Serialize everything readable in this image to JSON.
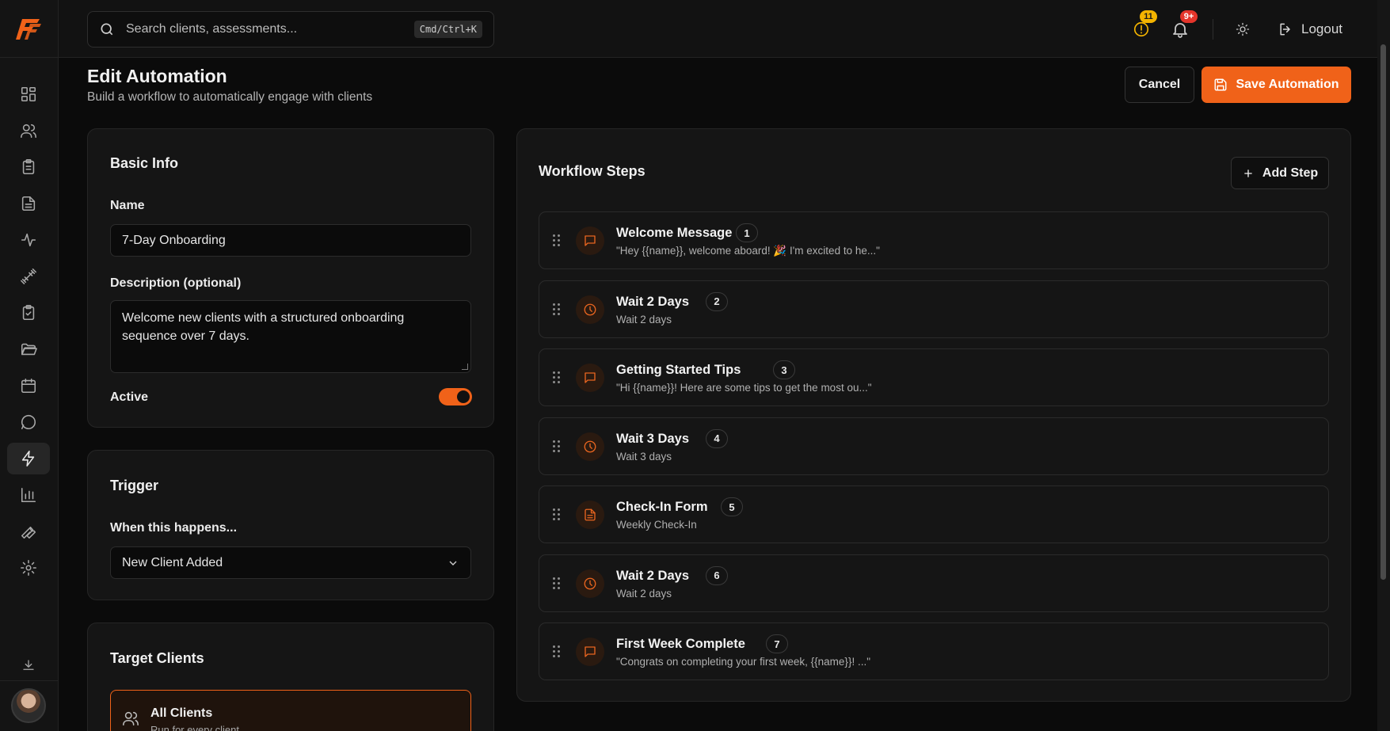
{
  "topbar": {
    "search_placeholder": "Search clients, assessments...",
    "search_shortcut": "Cmd/Ctrl+K",
    "alerts_badge": "11",
    "notifications_badge": "9+",
    "logout_label": "Logout"
  },
  "colors": {
    "accent": "#f06219",
    "background": "#0b0b0b",
    "card": "#151515"
  },
  "sidebar": {
    "logo": "FF",
    "items": [
      {
        "icon": "dashboard-icon"
      },
      {
        "icon": "users-icon"
      },
      {
        "icon": "clipboard-icon"
      },
      {
        "icon": "document-icon"
      },
      {
        "icon": "activity-icon"
      },
      {
        "icon": "dumbbell-icon"
      },
      {
        "icon": "clipboard-check-icon"
      },
      {
        "icon": "folder-icon"
      },
      {
        "icon": "calendar-icon"
      },
      {
        "icon": "chat-icon"
      },
      {
        "icon": "lightning-icon",
        "active": true
      },
      {
        "icon": "bar-chart-icon"
      },
      {
        "icon": "wrench-icon"
      },
      {
        "icon": "gear-icon"
      }
    ]
  },
  "header": {
    "title": "Edit Automation",
    "subtitle": "Build a workflow to automatically engage with clients",
    "cancel_label": "Cancel",
    "save_label": "Save Automation"
  },
  "basic_info": {
    "title": "Basic Info",
    "name_label": "Name",
    "name_value": "7-Day Onboarding",
    "description_label": "Description (optional)",
    "description_value": "Welcome new clients with a structured onboarding sequence over 7 days.",
    "active_label": "Active",
    "active": true
  },
  "trigger": {
    "title": "Trigger",
    "when_label": "When this happens...",
    "selected": "New Client Added"
  },
  "target": {
    "title": "Target Clients",
    "option_title": "All Clients",
    "option_sub": "Run for every client"
  },
  "workflow": {
    "title": "Workflow Steps",
    "add_label": "Add Step",
    "steps": [
      {
        "type": "message",
        "title": "Welcome Message",
        "num": "1",
        "sub": "\"Hey {{name}}, welcome aboard! 🎉 I'm excited to he...\""
      },
      {
        "type": "wait",
        "title": "Wait 2 Days",
        "num": "2",
        "sub": "Wait 2 days"
      },
      {
        "type": "message",
        "title": "Getting Started Tips",
        "num": "3",
        "sub": "\"Hi {{name}}! Here are some tips to get the most ou...\""
      },
      {
        "type": "wait",
        "title": "Wait 3 Days",
        "num": "4",
        "sub": "Wait 3 days"
      },
      {
        "type": "form",
        "title": "Check-In Form",
        "num": "5",
        "sub": "Weekly Check-In"
      },
      {
        "type": "wait",
        "title": "Wait 2 Days",
        "num": "6",
        "sub": "Wait 2 days"
      },
      {
        "type": "message",
        "title": "First Week Complete",
        "num": "7",
        "sub": "\"Congrats on completing your first week, {{name}}! ...\""
      }
    ]
  }
}
